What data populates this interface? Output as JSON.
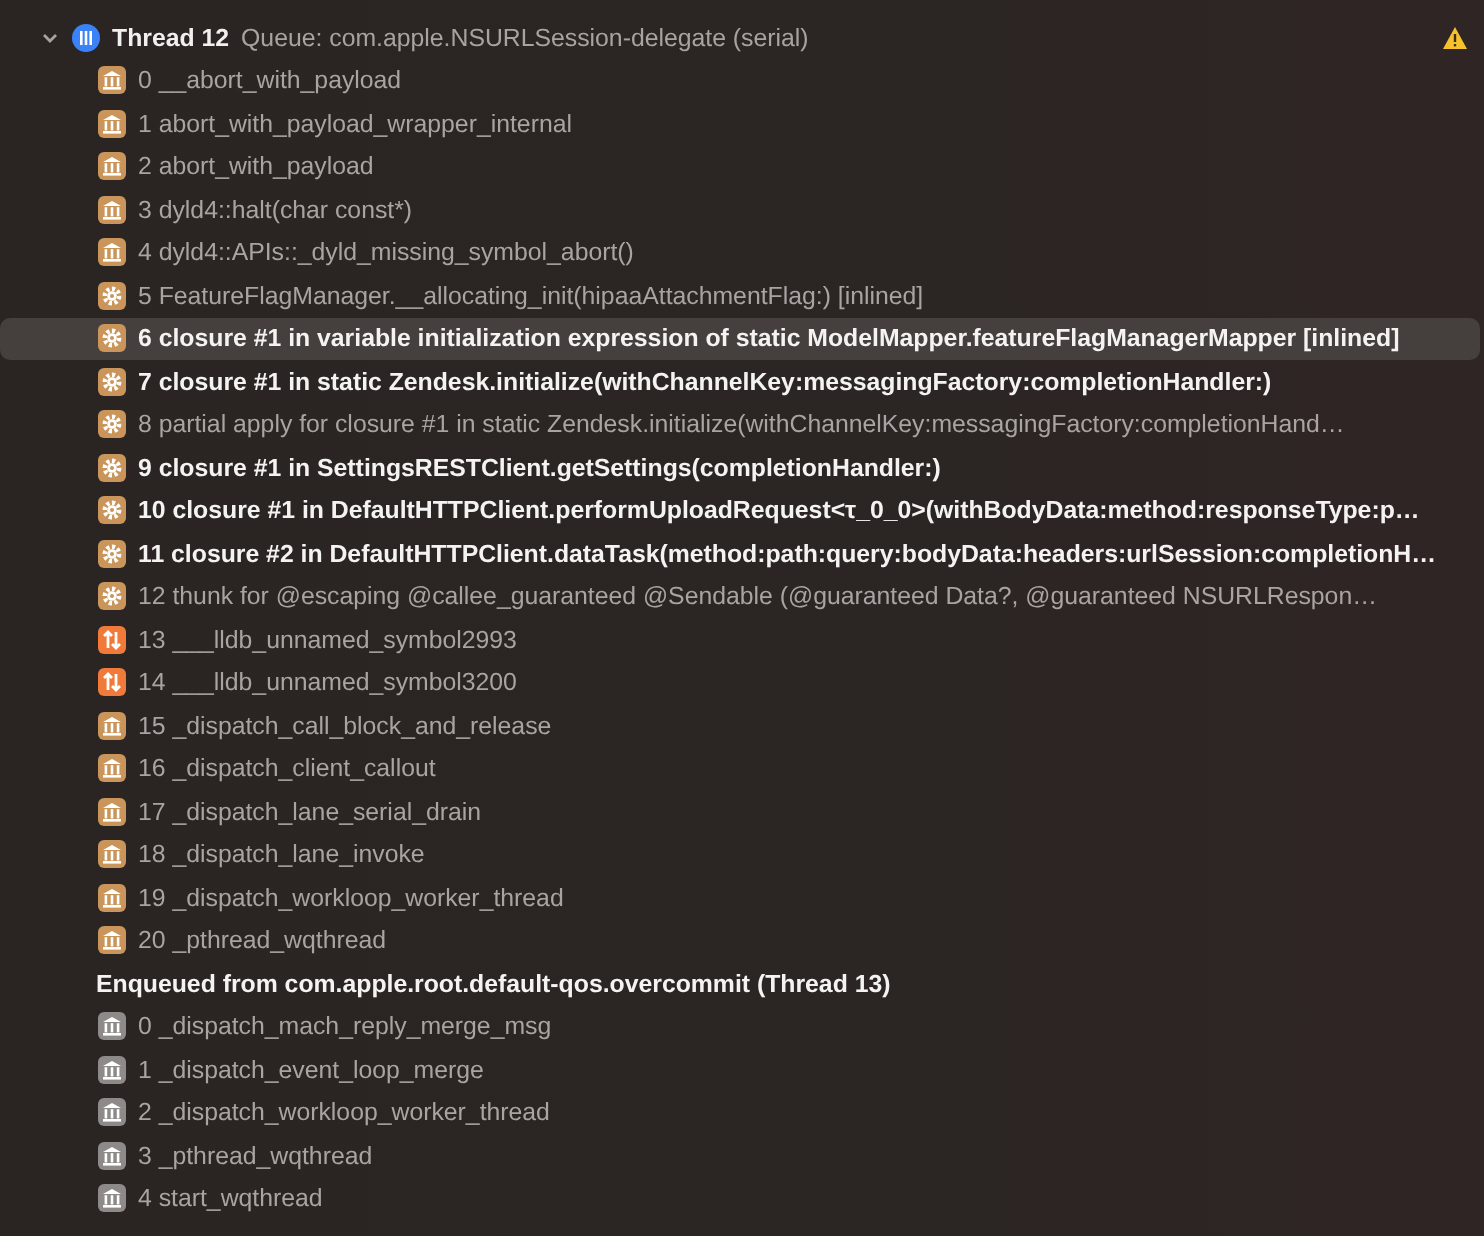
{
  "threads": [
    {
      "name": "Thread 12",
      "queue": "Queue: com.apple.NSURLSession-delegate (serial)",
      "expanded": true,
      "warning": true,
      "frames": [
        {
          "label": "0 __abort_with_payload",
          "kind": "library",
          "emphasized": false,
          "selected": false
        },
        {
          "label": "1 abort_with_payload_wrapper_internal",
          "kind": "library",
          "emphasized": false,
          "selected": false
        },
        {
          "label": "2 abort_with_payload",
          "kind": "library",
          "emphasized": false,
          "selected": false
        },
        {
          "label": "3 dyld4::halt(char const*)",
          "kind": "library",
          "emphasized": false,
          "selected": false
        },
        {
          "label": "4 dyld4::APIs::_dyld_missing_symbol_abort()",
          "kind": "library",
          "emphasized": false,
          "selected": false
        },
        {
          "label": "5 FeatureFlagManager.__allocating_init(hipaaAttachmentFlag:) [inlined]",
          "kind": "user",
          "emphasized": false,
          "selected": false
        },
        {
          "label": "6 closure #1 in variable initialization expression of static ModelMapper.featureFlagManagerMapper [inlined]",
          "kind": "user",
          "emphasized": true,
          "selected": true
        },
        {
          "label": "7 closure #1 in static Zendesk.initialize(withChannelKey:messagingFactory:completionHandler:)",
          "kind": "user",
          "emphasized": true,
          "selected": false
        },
        {
          "label": "8 partial apply for closure #1 in static Zendesk.initialize(withChannelKey:messagingFactory:completionHand…",
          "kind": "user",
          "emphasized": false,
          "selected": false
        },
        {
          "label": "9 closure #1 in SettingsRESTClient.getSettings(completionHandler:)",
          "kind": "user",
          "emphasized": true,
          "selected": false
        },
        {
          "label": "10 closure #1 in DefaultHTTPClient.performUploadRequest<τ_0_0>(withBodyData:method:responseType:p…",
          "kind": "user",
          "emphasized": true,
          "selected": false
        },
        {
          "label": "11 closure #2 in DefaultHTTPClient.dataTask(method:path:query:bodyData:headers:urlSession:completionH…",
          "kind": "user",
          "emphasized": true,
          "selected": false
        },
        {
          "label": "12 thunk for @escaping @callee_guaranteed @Sendable (@guaranteed Data?, @guaranteed NSURLRespon…",
          "kind": "user",
          "emphasized": false,
          "selected": false
        },
        {
          "label": "13 ___lldb_unnamed_symbol2993",
          "kind": "symbol",
          "emphasized": false,
          "selected": false
        },
        {
          "label": "14 ___lldb_unnamed_symbol3200",
          "kind": "symbol",
          "emphasized": false,
          "selected": false
        },
        {
          "label": "15 _dispatch_call_block_and_release",
          "kind": "library",
          "emphasized": false,
          "selected": false
        },
        {
          "label": "16 _dispatch_client_callout",
          "kind": "library",
          "emphasized": false,
          "selected": false
        },
        {
          "label": "17 _dispatch_lane_serial_drain",
          "kind": "library",
          "emphasized": false,
          "selected": false
        },
        {
          "label": "18 _dispatch_lane_invoke",
          "kind": "library",
          "emphasized": false,
          "selected": false
        },
        {
          "label": "19 _dispatch_workloop_worker_thread",
          "kind": "library",
          "emphasized": false,
          "selected": false
        },
        {
          "label": "20 _pthread_wqthread",
          "kind": "library",
          "emphasized": false,
          "selected": false
        }
      ],
      "enqueued": {
        "title": "Enqueued from com.apple.root.default-qos.overcommit (Thread 13)",
        "frames": [
          {
            "label": "0 _dispatch_mach_reply_merge_msg",
            "kind": "system",
            "emphasized": false,
            "selected": false
          },
          {
            "label": "1 _dispatch_event_loop_merge",
            "kind": "system",
            "emphasized": false,
            "selected": false
          },
          {
            "label": "2 _dispatch_workloop_worker_thread",
            "kind": "system",
            "emphasized": false,
            "selected": false
          },
          {
            "label": "3 _pthread_wqthread",
            "kind": "system",
            "emphasized": false,
            "selected": false
          },
          {
            "label": "4 start_wqthread",
            "kind": "system",
            "emphasized": false,
            "selected": false
          }
        ]
      }
    }
  ]
}
